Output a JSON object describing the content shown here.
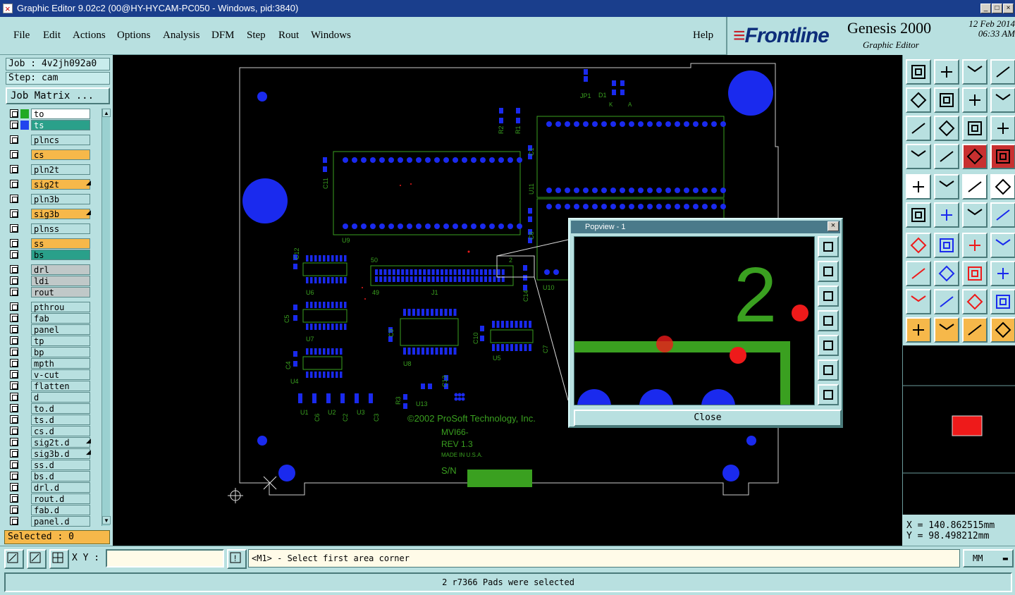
{
  "window": {
    "title": "Graphic Editor 9.02c2 (00@HY-HYCAM-PC050 - Windows, pid:3840)"
  },
  "menu": {
    "items": [
      "File",
      "Edit",
      "Actions",
      "Options",
      "Analysis",
      "DFM",
      "Step",
      "Rout",
      "Windows"
    ],
    "help": "Help"
  },
  "brand": {
    "logo": "Frontline",
    "product": "Genesis 2000",
    "subtitle": "Graphic Editor",
    "date": "12 Feb 2014",
    "time": "06:33 AM"
  },
  "job": {
    "job_label": "Job : 4v2jh092a0",
    "step_label": "Step: cam",
    "matrix_button": "Job Matrix ..."
  },
  "layers": [
    {
      "name": "to",
      "style": "white",
      "swatch": "#22aa22"
    },
    {
      "name": "ts",
      "style": "ts",
      "swatch": "#2244ee"
    },
    {
      "name": "plncs",
      "style": "plain"
    },
    {
      "name": "cs",
      "style": "orange"
    },
    {
      "name": "pln2t",
      "style": "plain"
    },
    {
      "name": "sig2t",
      "style": "orange",
      "flag": true
    },
    {
      "name": "pln3b",
      "style": "plain"
    },
    {
      "name": "sig3b",
      "style": "orange",
      "flag": true
    },
    {
      "name": "plnss",
      "style": "plain"
    },
    {
      "name": "ss",
      "style": "orange"
    },
    {
      "name": "bs",
      "style": "green"
    },
    {
      "name": "drl",
      "style": "grey"
    },
    {
      "name": "ldi",
      "style": "grey"
    },
    {
      "name": "rout",
      "style": "grey"
    },
    {
      "name": "pthrou",
      "style": "plain"
    },
    {
      "name": "fab",
      "style": "plain"
    },
    {
      "name": "panel",
      "style": "plain"
    },
    {
      "name": "tp",
      "style": "plain"
    },
    {
      "name": "bp",
      "style": "plain"
    },
    {
      "name": "mpth",
      "style": "plain"
    },
    {
      "name": "v-cut",
      "style": "plain"
    },
    {
      "name": "flatten",
      "style": "plain"
    },
    {
      "name": "d",
      "style": "plain"
    },
    {
      "name": "to.d",
      "style": "plain"
    },
    {
      "name": "ts.d",
      "style": "plain"
    },
    {
      "name": "cs.d",
      "style": "plain"
    },
    {
      "name": "sig2t.d",
      "style": "plain",
      "flag": true
    },
    {
      "name": "sig3b.d",
      "style": "plain",
      "flag": true
    },
    {
      "name": "ss.d",
      "style": "plain"
    },
    {
      "name": "bs.d",
      "style": "plain"
    },
    {
      "name": "drl.d",
      "style": "plain"
    },
    {
      "name": "rout.d",
      "style": "plain"
    },
    {
      "name": "fab.d",
      "style": "plain"
    },
    {
      "name": "panel.d",
      "style": "plain"
    }
  ],
  "selected": "Selected : 0",
  "board": {
    "silk_text": [
      "©2002 ProSoft Technology, Inc.",
      "MVI66-",
      "REV 1.3",
      "MADE IN U.S.A.",
      "S/N"
    ],
    "refdes": [
      "JP1",
      "D1",
      "K",
      "A",
      "R2",
      "R1",
      "C1",
      "U11",
      "C11",
      "U9",
      "C8",
      "C12",
      "U6",
      "50",
      "J1",
      "49",
      "2",
      "C14",
      "U10",
      "C5",
      "U7",
      "C9",
      "U8",
      "C10",
      "U5",
      "C7",
      "C4",
      "U4",
      "C13",
      "R3",
      "U13",
      "U1",
      "C6",
      "U2",
      "C2",
      "U3",
      "C3"
    ]
  },
  "popview": {
    "title": "Popview - 1",
    "close_label": "Close",
    "digit": "2"
  },
  "coords": {
    "x": "X = 140.862515mm",
    "y": "Y = 98.498212mm"
  },
  "cmd": {
    "xy_label": "X Y :",
    "xy_value": "",
    "prompt": "<M1> - Select first area corner",
    "units": "MM"
  },
  "status": "2 r7366 Pads were selected",
  "colors": {
    "bg": "#b8e0e0",
    "silk": "#3aa020",
    "pad": "#1a2aee",
    "selected_pad": "#ee1a1a",
    "accent": "#f6b84a"
  }
}
